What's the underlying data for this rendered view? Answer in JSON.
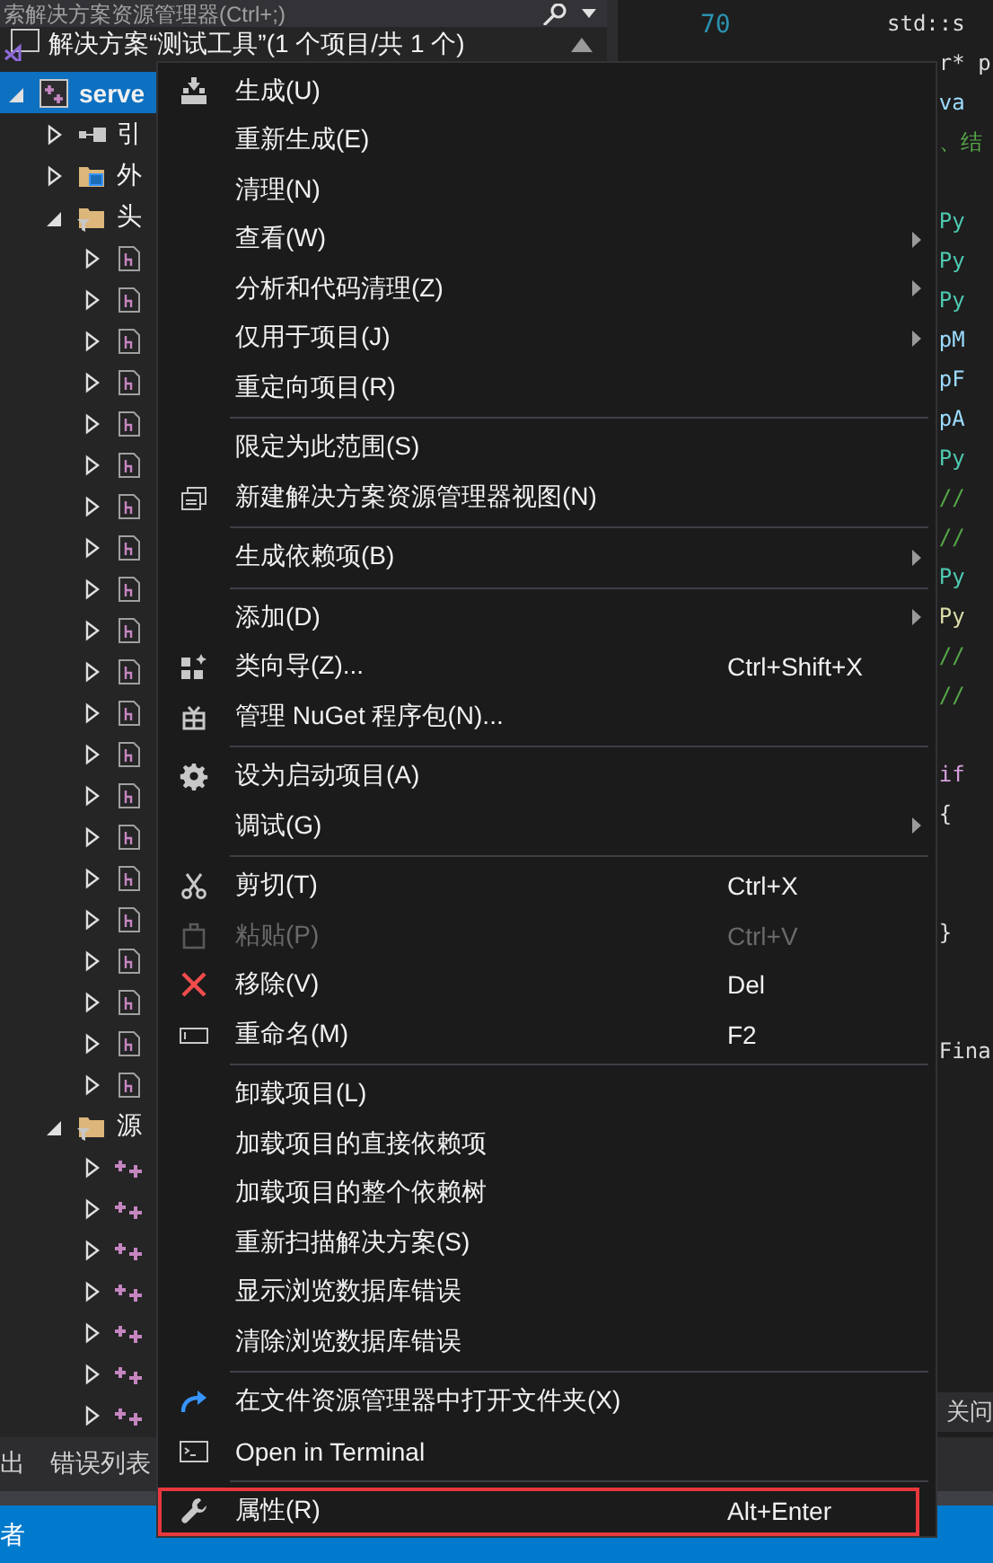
{
  "explorer": {
    "search": {
      "placeholder": "索解决方案资源管理器(Ctrl+;)"
    },
    "solution": {
      "label": "解决方案“测试工具”(1 个项目/共 1 个)"
    },
    "tree": [
      {
        "label": "serve",
        "kind": "project",
        "expanded": true,
        "selected": true,
        "children": [
          {
            "label": "引",
            "kind": "references",
            "expanded": false,
            "selected": false
          },
          {
            "label": "外",
            "kind": "external",
            "expanded": false,
            "selected": false
          },
          {
            "label": "头",
            "kind": "filter",
            "expanded": true,
            "selected": false,
            "children": [
              {
                "kind": "header",
                "expanded": false,
                "selected": false
              },
              {
                "kind": "header",
                "expanded": false,
                "selected": false
              },
              {
                "kind": "header",
                "expanded": false,
                "selected": false
              },
              {
                "kind": "header",
                "expanded": false,
                "selected": false
              },
              {
                "kind": "header",
                "expanded": false,
                "selected": false
              },
              {
                "kind": "header",
                "expanded": false,
                "selected": false
              },
              {
                "kind": "header",
                "expanded": false,
                "selected": false
              },
              {
                "kind": "header",
                "expanded": false,
                "selected": false
              },
              {
                "kind": "header",
                "expanded": false,
                "selected": false
              },
              {
                "kind": "header",
                "expanded": false,
                "selected": false
              },
              {
                "kind": "header",
                "expanded": false,
                "selected": false
              },
              {
                "kind": "header",
                "expanded": false,
                "selected": false
              },
              {
                "kind": "header",
                "expanded": false,
                "selected": false
              },
              {
                "kind": "header",
                "expanded": false,
                "selected": false
              },
              {
                "kind": "header",
                "expanded": false,
                "selected": false
              },
              {
                "kind": "header",
                "expanded": false,
                "selected": false
              },
              {
                "kind": "header",
                "expanded": false,
                "selected": false
              },
              {
                "kind": "header",
                "expanded": false,
                "selected": false
              },
              {
                "kind": "header",
                "expanded": false,
                "selected": false
              },
              {
                "kind": "header",
                "expanded": false,
                "selected": false
              },
              {
                "kind": "header",
                "expanded": false,
                "selected": false
              }
            ]
          },
          {
            "label": "源",
            "kind": "filter",
            "expanded": true,
            "selected": false,
            "children": [
              {
                "kind": "source",
                "expanded": false,
                "selected": false
              },
              {
                "kind": "source",
                "expanded": false,
                "selected": false
              },
              {
                "kind": "source",
                "expanded": false,
                "selected": false
              },
              {
                "kind": "source",
                "expanded": false,
                "selected": false
              },
              {
                "kind": "source",
                "expanded": false,
                "selected": false
              },
              {
                "kind": "source",
                "expanded": false,
                "selected": false
              },
              {
                "kind": "source",
                "expanded": false,
                "selected": false
              }
            ]
          }
        ]
      }
    ]
  },
  "editor": {
    "line_numbers": [
      "70"
    ],
    "lines": [
      {
        "kind": "plain",
        "text": "std::s"
      },
      {
        "kind": "plain",
        "text": "    r* p"
      },
      {
        "kind": "var",
        "text": "    va"
      },
      {
        "kind": "comment",
        "text": "    、结"
      },
      {
        "kind": "blank"
      },
      {
        "kind": "type",
        "text": "    Py"
      },
      {
        "kind": "type",
        "text": "    Py"
      },
      {
        "kind": "type",
        "text": "    Py"
      },
      {
        "kind": "var",
        "text": "    pM"
      },
      {
        "kind": "var",
        "text": "    pF"
      },
      {
        "kind": "var",
        "text": "    pA"
      },
      {
        "kind": "type",
        "text": "    Py"
      },
      {
        "kind": "comment",
        "text": "    //"
      },
      {
        "kind": "comment",
        "text": "    //"
      },
      {
        "kind": "type",
        "text": "    Py"
      },
      {
        "kind": "func",
        "text": "    Py"
      },
      {
        "kind": "comment",
        "text": "    //"
      },
      {
        "kind": "comment",
        "text": "    //"
      },
      {
        "kind": "blank"
      },
      {
        "kind": "keyword",
        "text": "    if"
      },
      {
        "kind": "plain",
        "text": "    {"
      },
      {
        "kind": "blank"
      },
      {
        "kind": "blank"
      },
      {
        "kind": "plain",
        "text": "    }"
      },
      {
        "kind": "blank"
      },
      {
        "kind": "blank"
      },
      {
        "kind": "plain",
        "text": "    Fina"
      }
    ],
    "bottom_bar": {
      "text": "关问"
    }
  },
  "panel_tabs": [
    {
      "label": "出"
    },
    {
      "label": "错误列表"
    }
  ],
  "status_bar": {
    "text": "者"
  },
  "menu": {
    "groups": [
      [
        {
          "label": "生成(U)",
          "kind": "build",
          "submenu": false,
          "disabled": false,
          "highlighted": false
        },
        {
          "label": "重新生成(E)",
          "submenu": false,
          "disabled": false,
          "highlighted": false
        },
        {
          "label": "清理(N)",
          "submenu": false,
          "disabled": false,
          "highlighted": false
        },
        {
          "label": "查看(W)",
          "submenu": true,
          "disabled": false,
          "highlighted": false
        },
        {
          "label": "分析和代码清理(Z)",
          "submenu": true,
          "disabled": false,
          "highlighted": false
        },
        {
          "label": "仅用于项目(J)",
          "submenu": true,
          "disabled": false,
          "highlighted": false
        },
        {
          "label": "重定向项目(R)",
          "submenu": false,
          "disabled": false,
          "highlighted": false
        }
      ],
      [
        {
          "label": "限定为此范围(S)",
          "submenu": false,
          "disabled": false,
          "highlighted": false
        },
        {
          "label": "新建解决方案资源管理器视图(N)",
          "kind": "new_view",
          "submenu": false,
          "disabled": false,
          "highlighted": false
        }
      ],
      [
        {
          "label": "生成依赖项(B)",
          "submenu": true,
          "disabled": false,
          "highlighted": false
        }
      ],
      [
        {
          "label": "添加(D)",
          "submenu": true,
          "disabled": false,
          "highlighted": false
        },
        {
          "label": "类向导(Z)...",
          "kind": "class_wizard",
          "shortcut": "Ctrl+Shift+X",
          "submenu": false,
          "disabled": false,
          "highlighted": false
        },
        {
          "label": "管理 NuGet 程序包(N)...",
          "kind": "package",
          "submenu": false,
          "disabled": false,
          "highlighted": false
        }
      ],
      [
        {
          "label": "设为启动项目(A)",
          "kind": "gear",
          "submenu": false,
          "disabled": false,
          "highlighted": false
        },
        {
          "label": "调试(G)",
          "submenu": true,
          "disabled": false,
          "highlighted": false
        }
      ],
      [
        {
          "label": "剪切(T)",
          "kind": "cut",
          "shortcut": "Ctrl+X",
          "submenu": false,
          "disabled": false,
          "highlighted": false
        },
        {
          "label": "粘贴(P)",
          "kind": "paste",
          "shortcut": "Ctrl+V",
          "submenu": false,
          "disabled": true,
          "highlighted": false
        },
        {
          "label": "移除(V)",
          "kind": "remove",
          "shortcut": "Del",
          "submenu": false,
          "disabled": false,
          "highlighted": false
        },
        {
          "label": "重命名(M)",
          "kind": "rename",
          "shortcut": "F2",
          "submenu": false,
          "disabled": false,
          "highlighted": false
        }
      ],
      [
        {
          "label": "卸载项目(L)",
          "submenu": false,
          "disabled": false,
          "highlighted": false
        },
        {
          "label": "加载项目的直接依赖项",
          "submenu": false,
          "disabled": false,
          "highlighted": false
        },
        {
          "label": "加载项目的整个依赖树",
          "submenu": false,
          "disabled": false,
          "highlighted": false
        },
        {
          "label": "重新扫描解决方案(S)",
          "submenu": false,
          "disabled": false,
          "highlighted": false
        },
        {
          "label": "显示浏览数据库错误",
          "submenu": false,
          "disabled": false,
          "highlighted": false
        },
        {
          "label": "清除浏览数据库错误",
          "submenu": false,
          "disabled": false,
          "highlighted": false
        }
      ],
      [
        {
          "label": "在文件资源管理器中打开文件夹(X)",
          "kind": "open_folder",
          "submenu": false,
          "disabled": false,
          "highlighted": false
        },
        {
          "label": "Open in Terminal",
          "kind": "terminal",
          "submenu": false,
          "disabled": false,
          "highlighted": false
        }
      ],
      [
        {
          "label": "属性(R)",
          "kind": "properties",
          "shortcut": "Alt+Enter",
          "submenu": false,
          "disabled": false,
          "highlighted": true
        }
      ]
    ]
  }
}
